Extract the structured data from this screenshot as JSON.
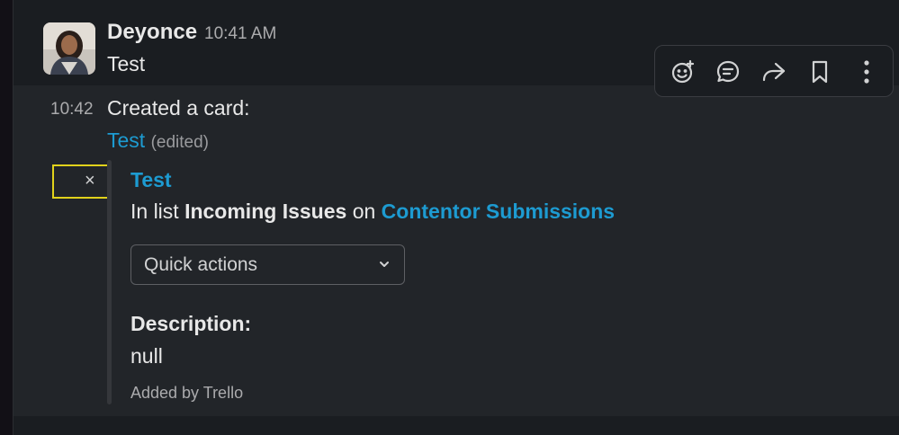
{
  "message1": {
    "sender": "Deyonce",
    "time": "10:41 AM",
    "text": "Test"
  },
  "toolbar": {
    "icons": [
      "add-reaction-icon",
      "reply-in-thread-icon",
      "share-icon",
      "bookmark-icon",
      "more-actions-icon"
    ]
  },
  "message2": {
    "time": "10:42",
    "text": "Created a card:",
    "link_text": "Test",
    "edited": "(edited)"
  },
  "attachment": {
    "close_symbol": "×",
    "title": "Test",
    "list_prefix": "In list",
    "list_name": "Incoming Issues",
    "list_mid": "on",
    "board_name": "Contentor Submissions",
    "select_label": "Quick actions",
    "description_heading": "Description:",
    "description_value": "null",
    "footer": "Added by Trello"
  },
  "colors": {
    "background": "#1a1d21",
    "hover_background": "#222529",
    "link": "#1d9bd1",
    "highlight_box": "#e1d21b"
  }
}
